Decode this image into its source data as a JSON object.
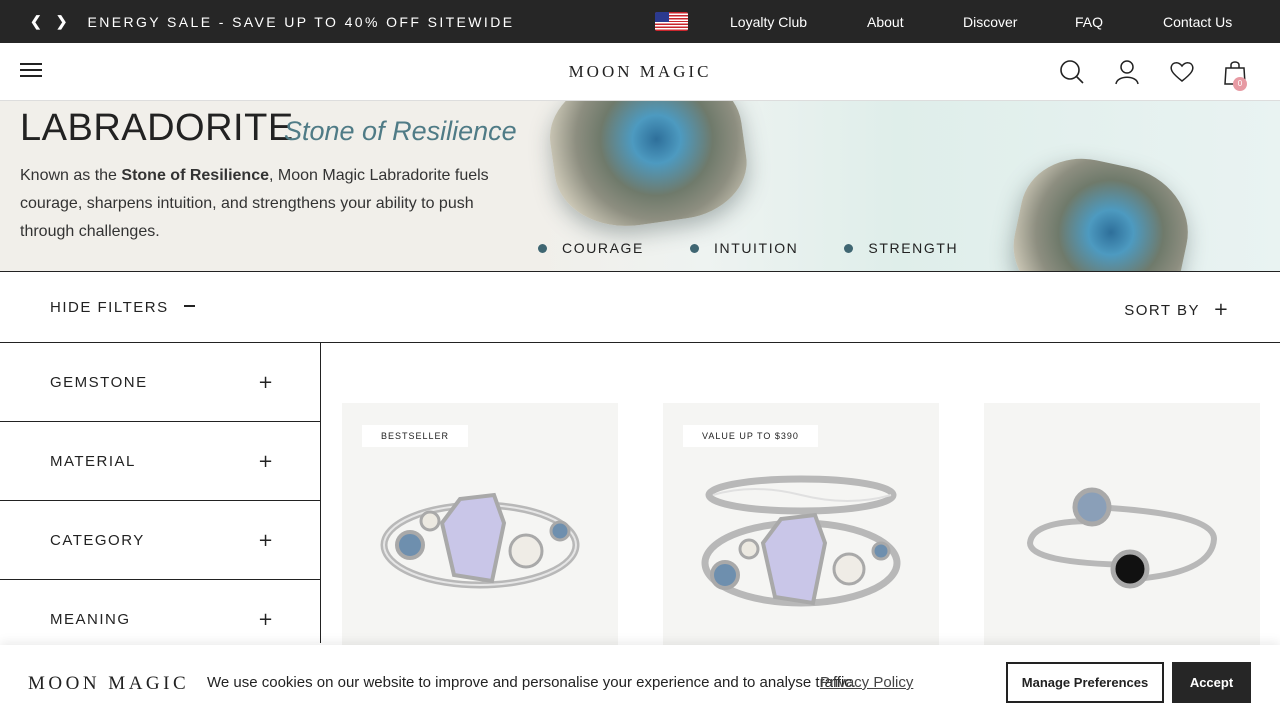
{
  "topbar": {
    "promo": "ENERGY SALE - SAVE UP TO 40% OFF SITEWIDE",
    "links": [
      "Loyalty Club",
      "About",
      "Discover",
      "FAQ",
      "Contact Us"
    ]
  },
  "header": {
    "logo": "MOON MAGIC",
    "cart_count": "0"
  },
  "hero": {
    "title": "LABRADORITE",
    "subtitle": "Stone of Resilience",
    "desc_pre": "Known as the ",
    "desc_bold": "Stone of Resilience",
    "desc_post": ", Moon Magic Labradorite fuels courage, sharpens intuition, and strengthens your ability to push through challenges.",
    "traits": [
      "COURAGE",
      "INTUITION",
      "STRENGTH"
    ]
  },
  "filterbar": {
    "hide_filters": "HIDE FILTERS",
    "sort_by": "SORT BY"
  },
  "filters": [
    "GEMSTONE",
    "MATERIAL",
    "CATEGORY",
    "MEANING"
  ],
  "products": [
    {
      "tag": "BESTSELLER"
    },
    {
      "tag": "VALUE UP TO $390"
    },
    {
      "tag": ""
    }
  ],
  "cookie": {
    "logo": "MOON MAGIC",
    "text": "We use cookies on our website to improve and personalise your experience and to analyse traffic.",
    "link": "Privacy Policy",
    "manage": "Manage Preferences",
    "accept": "Accept"
  },
  "colors": {
    "topbar_bg": "#262626",
    "accent_teal": "#4f7b86",
    "trait_dot": "#3f6672",
    "cart_badge": "#e79aa3"
  }
}
